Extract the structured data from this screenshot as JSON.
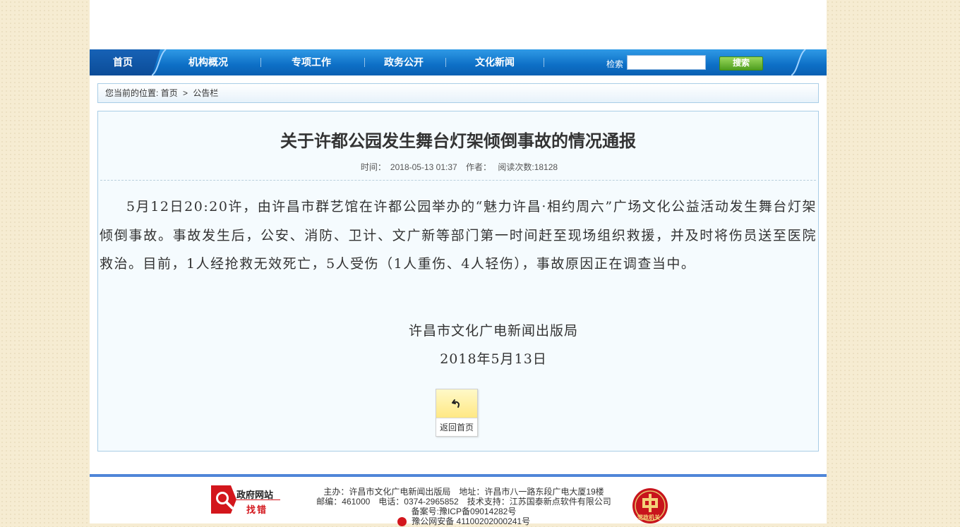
{
  "nav": {
    "items": [
      "首页",
      "机构概况",
      "专项工作",
      "政务公开",
      "文化新闻"
    ],
    "search_label": "检索",
    "search_value": "",
    "search_button": "搜索"
  },
  "breadcrumb": {
    "prefix": "您当前的位置:",
    "home": "首页",
    "separator": ">",
    "current": "公告栏"
  },
  "article": {
    "title": "关于许都公园发生舞台灯架倾倒事故的情况通报",
    "time_label": "时间：",
    "time": "2018-05-13 01:37",
    "author_label": "作者：",
    "reads": "阅读次数:18128",
    "body": "5月12日20:20许，由许昌市群艺馆在许都公园举办的“魅力许昌·相约周六”广场文化公益活动发生舞台灯架倾倒事故。事故发生后，公安、消防、卫计、文广新等部门第一时间赶至现场组织救援，并及时将伤员送至医院救治。目前，1人经抢救无效死亡，5人受伤（1人重伤、4人轻伤），事故原因正在调查当中。",
    "signature": "许昌市文化广电新闻出版局",
    "date": "2018年5月13日",
    "back_label": "返回首页"
  },
  "footer": {
    "gov_site_label": "政府网站",
    "find_error_label": "找错",
    "sponsor": "主办：许昌市文化广电新闻出版局　地址：许昌市八一路东段广电大厦19楼",
    "contact": "邮编：461000　电话：0374-2965852　技术支持：江苏国泰新点软件有限公司",
    "icp": "备案号:豫ICP备09014282号",
    "police": "豫公网安备 41100202000241号",
    "party_badge_label": "党政机关"
  },
  "colors": {
    "nav_blue": "#0d6fc6",
    "accent_green": "#4e9e1f",
    "footer_blue": "#4f86d8",
    "error_red": "#d3161c"
  }
}
